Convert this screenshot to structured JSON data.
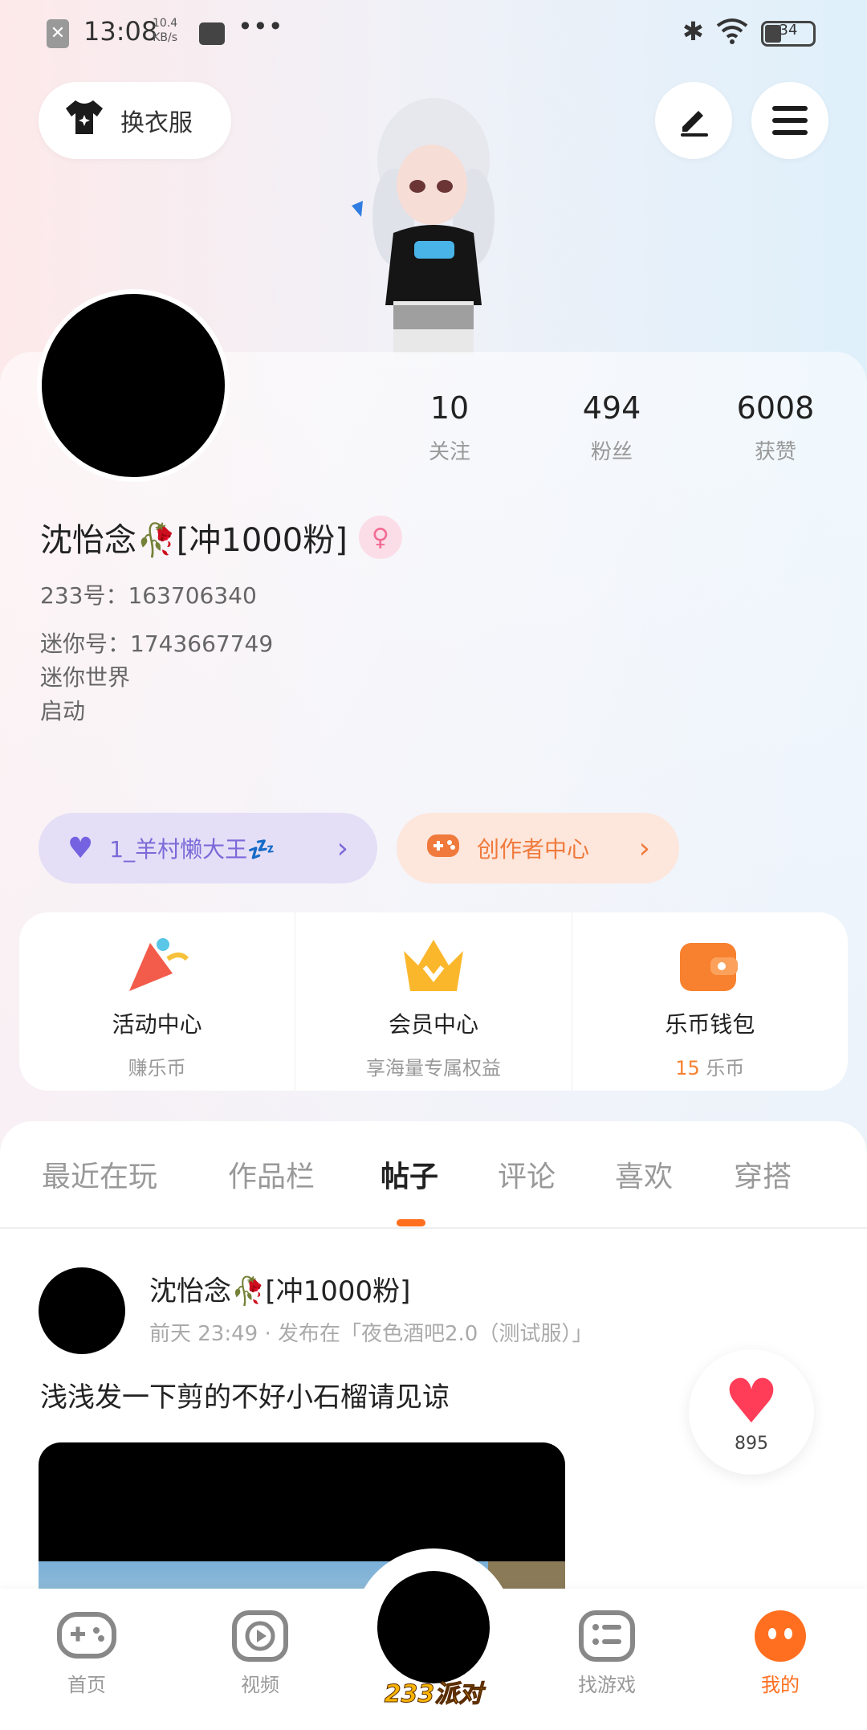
{
  "status_bar": {
    "time": "13:08",
    "net_speed_top": "10.4",
    "net_speed_unit": "KB/s",
    "battery": "34"
  },
  "top": {
    "outfit_label": "换衣服"
  },
  "profile": {
    "stats": [
      {
        "value": "10",
        "label": "关注"
      },
      {
        "value": "494",
        "label": "粉丝"
      },
      {
        "value": "6008",
        "label": "获赞"
      }
    ],
    "name": "沈怡念🥀[冲1000粉]",
    "gender_symbol": "♀",
    "id_233": "233号：163706340",
    "mini_id": "迷你号：1743667749",
    "line1": "迷你世界",
    "line2": "启动"
  },
  "chips": {
    "friend": "1_羊村懒大王💤",
    "creator": "创作者中心"
  },
  "features": [
    {
      "title": "活动中心",
      "sub": "赚乐币"
    },
    {
      "title": "会员中心",
      "sub": "享海量专属权益"
    },
    {
      "title": "乐币钱包",
      "sub_num": "15",
      "sub": " 乐币"
    }
  ],
  "tabs": [
    "最近在玩",
    "作品栏",
    "帖子",
    "评论",
    "喜欢",
    "穿搭"
  ],
  "post": {
    "author": "沈怡念🥀[冲1000粉]",
    "meta": "前天 23:49 · 发布在「夜色酒吧2.0（测试服）」",
    "text": "浅浅发一下剪的不好小石榴请见谅",
    "likes": "895"
  },
  "nav": {
    "home": "首页",
    "video": "视频",
    "center": "233派对",
    "find": "找游戏",
    "me": "我的"
  },
  "colors": {
    "accent": "#ff6f1f",
    "chip_friend_bg": "#e4dff7",
    "chip_creator_bg": "#fde6dc"
  }
}
